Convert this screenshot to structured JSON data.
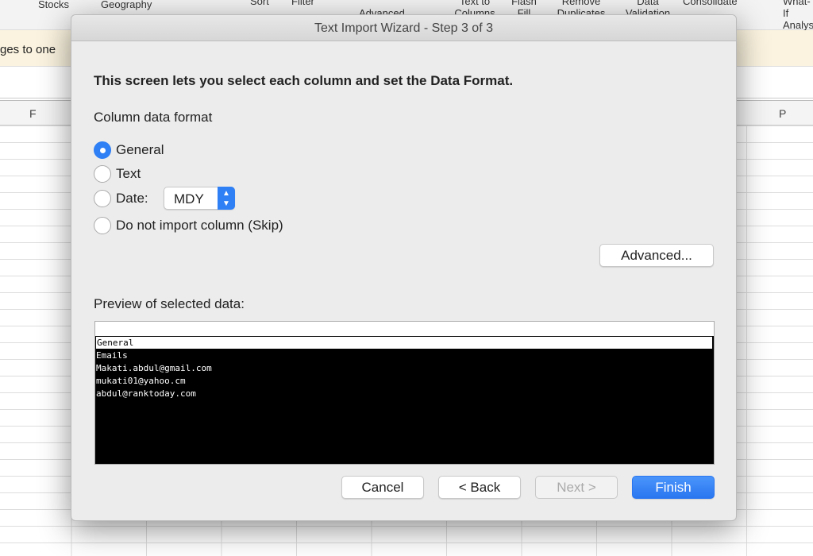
{
  "ribbon": {
    "items": [
      "Stocks",
      "Geography",
      "Sort",
      "Filter",
      "Advanced",
      "Text to Columns",
      "Flash Fill",
      "Remove Duplicates",
      "Data Validation",
      "Consolidate",
      "What-If Analysis"
    ]
  },
  "message_bar": {
    "text": "ges to one"
  },
  "columns": {
    "left": "F",
    "right": "P"
  },
  "dialog": {
    "title": "Text Import Wizard - Step 3 of 3",
    "heading": "This screen lets you select each column and set the Data Format.",
    "format_label": "Column data format",
    "options": [
      {
        "label": "General",
        "selected": true
      },
      {
        "label": "Text",
        "selected": false
      },
      {
        "label": "Date:",
        "selected": false
      },
      {
        "label": "Do not import column (Skip)",
        "selected": false
      }
    ],
    "date_format": "MDY",
    "advanced_label": "Advanced...",
    "preview_label": "Preview of selected data:",
    "preview": {
      "header": "General",
      "rows": [
        "Emails",
        "Makati.abdul@gmail.com",
        "mukati01@yahoo.cm",
        "abdul@ranktoday.com"
      ]
    },
    "buttons": {
      "cancel": "Cancel",
      "back": "< Back",
      "next": "Next >",
      "finish": "Finish"
    },
    "accent": "#2f7ff5"
  }
}
